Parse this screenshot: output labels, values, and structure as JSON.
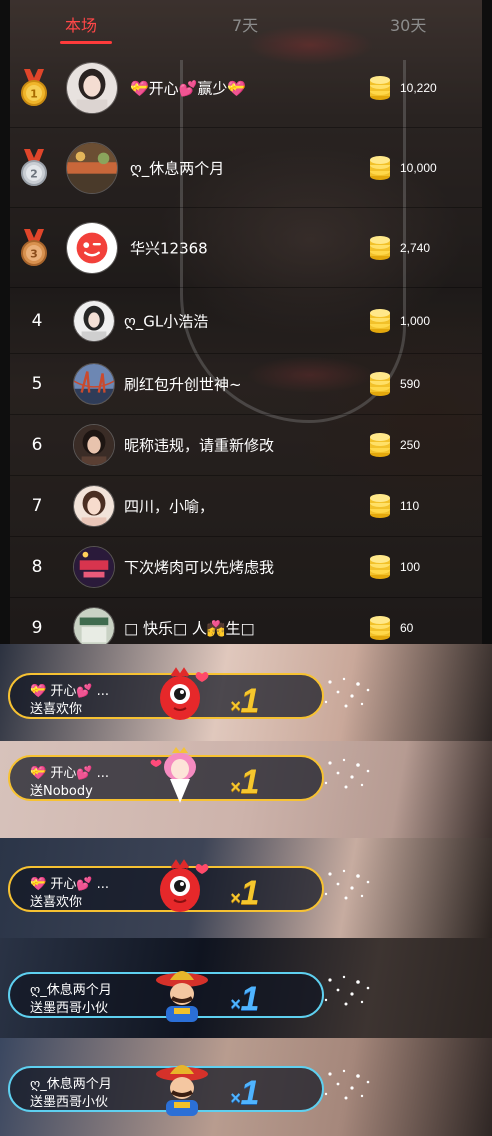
{
  "tabs": {
    "current": "本场",
    "seven_days": "7天",
    "thirty_days": "30天"
  },
  "ranking": [
    {
      "rank": "1",
      "name": "💝开心💕赢少💝",
      "amount": "10,220",
      "medal": "gold-medal"
    },
    {
      "rank": "2",
      "name": "ღ_休息两个月",
      "amount": "10,000",
      "medal": "silver-medal"
    },
    {
      "rank": "3",
      "name": "华兴12368",
      "amount": "2,740",
      "medal": "bronze-medal"
    },
    {
      "rank": "4",
      "name": "ღ_GL小浩浩",
      "amount": "1,000"
    },
    {
      "rank": "5",
      "name": "刷红包升创世神~",
      "amount": "590"
    },
    {
      "rank": "6",
      "name": "昵称违规，请重新修改",
      "amount": "250"
    },
    {
      "rank": "7",
      "name": "四川，小喻，",
      "amount": "110"
    },
    {
      "rank": "8",
      "name": "下次烤肉可以先烤虑我",
      "amount": "100"
    },
    {
      "rank": "9",
      "name": "□ 快乐□ 人💏生□",
      "amount": "60"
    }
  ],
  "gifts": [
    {
      "sender": "💝 开心💕 ...",
      "action": "送喜欢你",
      "times": "×",
      "count": "1",
      "style": "gold",
      "icon": "red-monster-icon"
    },
    {
      "sender": "💝 开心💕 ...",
      "action": "送Nobody",
      "times": "×",
      "count": "1",
      "style": "gold",
      "icon": "pink-princess-icon"
    },
    {
      "sender": "💝 开心💕 ...",
      "action": "送喜欢你",
      "times": "×",
      "count": "1",
      "style": "gold",
      "icon": "red-monster-icon"
    },
    {
      "sender": "ღ_休息两个月",
      "action": "送墨西哥小伙",
      "times": "×",
      "count": "1",
      "style": "blue",
      "icon": "mexican-guy-icon"
    },
    {
      "sender": "ღ_休息两个月",
      "action": "送墨西哥小伙",
      "times": "×",
      "count": "1",
      "style": "blue",
      "icon": "mexican-guy-icon"
    }
  ],
  "colors": {
    "active_tab": "#ff4747",
    "gold_border": "#f7c232",
    "blue_border": "#5ed0f0",
    "combo_gold": "#f6c72d",
    "combo_blue": "#4fb4ff"
  }
}
